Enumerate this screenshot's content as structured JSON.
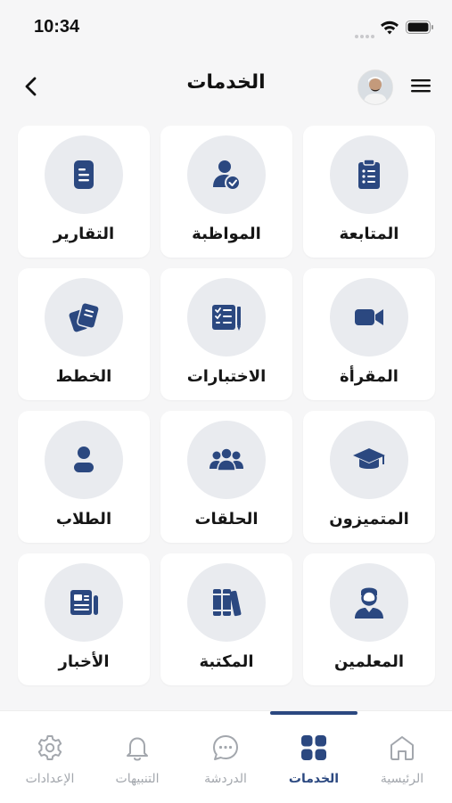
{
  "status_bar": {
    "time": "10:34"
  },
  "header": {
    "title": "الخدمات"
  },
  "colors": {
    "accent": "#2b4880",
    "icon_bg": "#e9ebef",
    "inactive": "#a3a7ad"
  },
  "services": [
    {
      "label": "المتابعة",
      "icon": "clipboard-list-icon"
    },
    {
      "label": "المواظبة",
      "icon": "user-check-icon"
    },
    {
      "label": "التقارير",
      "icon": "document-icon"
    },
    {
      "label": "المقرأة",
      "icon": "video-camera-icon"
    },
    {
      "label": "الاختبارات",
      "icon": "test-checklist-icon"
    },
    {
      "label": "الخطط",
      "icon": "plans-documents-icon"
    },
    {
      "label": "المتميزون",
      "icon": "graduation-cap-icon"
    },
    {
      "label": "الحلقات",
      "icon": "group-users-icon"
    },
    {
      "label": "الطلاب",
      "icon": "student-person-icon"
    },
    {
      "label": "المعلمين",
      "icon": "teacher-bearded-icon"
    },
    {
      "label": "المكتبة",
      "icon": "library-books-icon"
    },
    {
      "label": "الأخبار",
      "icon": "newspaper-icon"
    }
  ],
  "bottom_nav": {
    "items": [
      {
        "label": "الرئيسية",
        "icon": "home-icon",
        "active": false
      },
      {
        "label": "الخدمات",
        "icon": "grid-icon",
        "active": true
      },
      {
        "label": "الدردشة",
        "icon": "chat-bubble-icon",
        "active": false
      },
      {
        "label": "التنبيهات",
        "icon": "bell-icon",
        "active": false
      },
      {
        "label": "الإعدادات",
        "icon": "settings-gear-icon",
        "active": false
      }
    ]
  }
}
